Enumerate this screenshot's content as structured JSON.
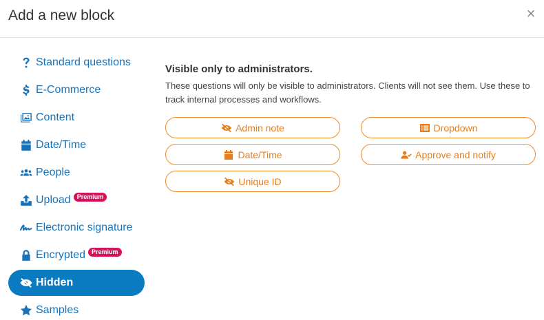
{
  "dialog": {
    "title": "Add a new block",
    "close_label": "×"
  },
  "sidebar": {
    "items": [
      {
        "label": "Standard questions",
        "icon": "question-icon"
      },
      {
        "label": "E-Commerce",
        "icon": "dollar-icon"
      },
      {
        "label": "Content",
        "icon": "images-icon"
      },
      {
        "label": "Date/Time",
        "icon": "calendar-icon"
      },
      {
        "label": "People",
        "icon": "users-icon"
      },
      {
        "label": "Upload",
        "icon": "upload-icon",
        "badge": "Premium"
      },
      {
        "label": "Electronic signature",
        "icon": "signature-icon"
      },
      {
        "label": "Encrypted",
        "icon": "lock-icon",
        "badge": "Premium"
      },
      {
        "label": "Hidden",
        "icon": "eye-slash-icon",
        "active": true
      },
      {
        "label": "Samples",
        "icon": "star-icon"
      }
    ]
  },
  "section": {
    "title": "Visible only to administrators.",
    "description": "These questions will only be visible to administrators. Clients will not see them. Use these to track internal processes and workflows."
  },
  "blocks": [
    {
      "label": "Admin note",
      "icon": "eye-slash-icon"
    },
    {
      "label": "Dropdown",
      "icon": "list-icon"
    },
    {
      "label": "Date/Time",
      "icon": "calendar-icon"
    },
    {
      "label": "Approve and notify",
      "icon": "user-check-icon"
    },
    {
      "label": "Unique ID",
      "icon": "eye-slash-icon"
    }
  ],
  "colors": {
    "accent_blue": "#1a73b8",
    "active_bg": "#0a7bc1",
    "orange": "#f08b24",
    "premium": "#d4135a"
  }
}
